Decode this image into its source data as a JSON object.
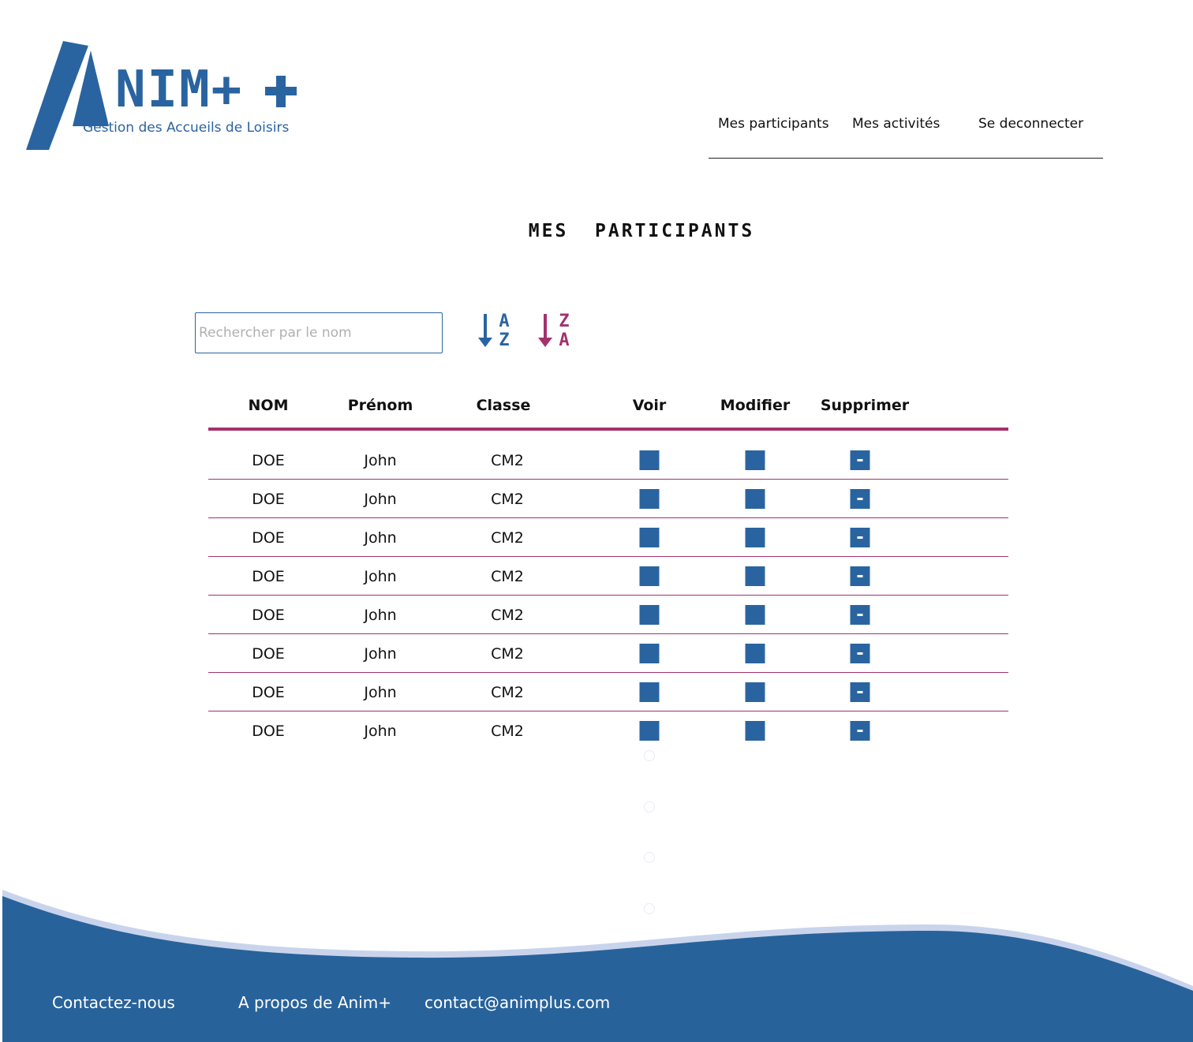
{
  "brand": {
    "name": "NIM+",
    "tagline": "Gestion des Accueils de Loisirs",
    "color": "#2a64a0",
    "accent": "#a2326e"
  },
  "nav": {
    "items": [
      "Mes participants",
      "Mes activités",
      "Se deconnecter"
    ]
  },
  "page": {
    "title": "MES  PARTICIPANTS"
  },
  "search": {
    "placeholder": "Rechercher par le nom",
    "value": ""
  },
  "sort": {
    "asc": {
      "icon": "sort-alpha-asc-icon",
      "top": "A",
      "bottom": "Z"
    },
    "desc": {
      "icon": "sort-alpha-desc-icon",
      "top": "Z",
      "bottom": "A"
    }
  },
  "table": {
    "headers": [
      "NOM",
      "Prénom",
      "Classe",
      "Voir",
      "Modifier",
      "Supprimer"
    ],
    "rows": [
      {
        "nom": "DOE",
        "prenom": "John",
        "classe": "CM2"
      },
      {
        "nom": "DOE",
        "prenom": "John",
        "classe": "CM2"
      },
      {
        "nom": "DOE",
        "prenom": "John",
        "classe": "CM2"
      },
      {
        "nom": "DOE",
        "prenom": "John",
        "classe": "CM2"
      },
      {
        "nom": "DOE",
        "prenom": "John",
        "classe": "CM2"
      },
      {
        "nom": "DOE",
        "prenom": "John",
        "classe": "CM2"
      },
      {
        "nom": "DOE",
        "prenom": "John",
        "classe": "CM2"
      },
      {
        "nom": "DOE",
        "prenom": "John",
        "classe": "CM2"
      }
    ]
  },
  "footer": {
    "links": [
      "Contactez-nous",
      "A propos de Anim+",
      "contact@animplus.com"
    ],
    "color": "#28629b"
  }
}
